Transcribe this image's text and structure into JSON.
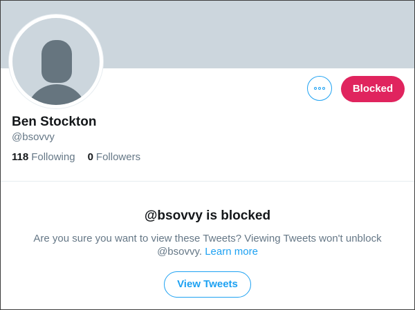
{
  "profile": {
    "name": "Ben Stockton",
    "handle": "@bsovvy",
    "following_count": "118",
    "following_label": "Following",
    "followers_count": "0",
    "followers_label": "Followers"
  },
  "actions": {
    "more_icon": "more-dots-icon",
    "blocked_label": "Blocked"
  },
  "blocked_notice": {
    "title": "@bsovvy is blocked",
    "message": "Are you sure you want to view these Tweets? Viewing Tweets won't unblock @bsovvy.",
    "learn_more": "Learn more",
    "view_button": "View Tweets"
  },
  "colors": {
    "banner": "#ccd6dd",
    "blocked_button": "#e0245e",
    "accent": "#1da1f2",
    "secondary_text": "#657786"
  }
}
